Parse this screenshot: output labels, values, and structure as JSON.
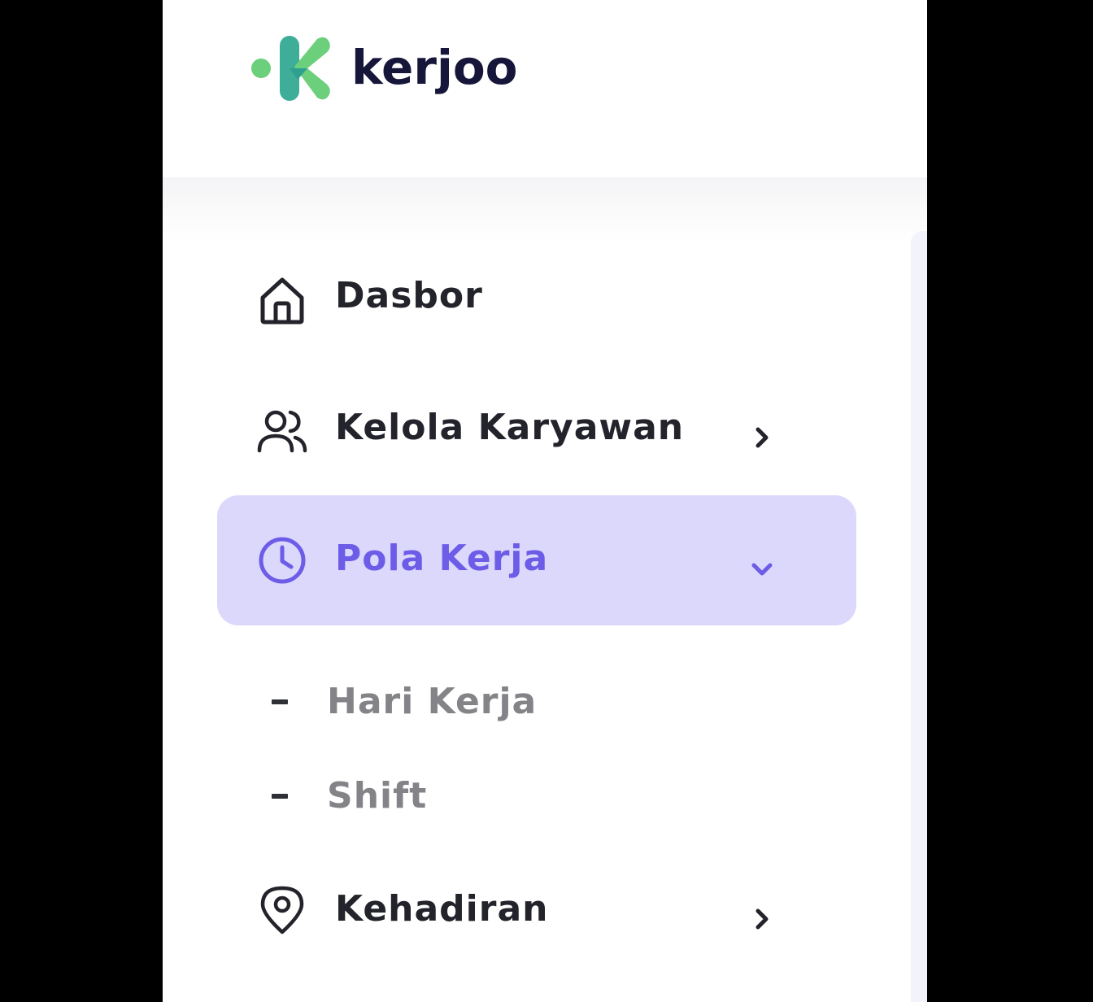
{
  "brand": {
    "name": "kerjoo",
    "logo_colors": [
      "#6ccf7b",
      "#3fae99",
      "#2ea08f"
    ],
    "text_color": "#16163a"
  },
  "sidebar": {
    "active_bg": "#dcd8fc",
    "active_color": "#6c5ce7",
    "items": [
      {
        "label": "Dasbor",
        "icon": "home-icon",
        "has_chevron": false
      },
      {
        "label": "Kelola Karyawan",
        "icon": "users-icon",
        "has_chevron": true,
        "chevron": "chevron-right-icon"
      },
      {
        "label": "Pola Kerja",
        "icon": "clock-icon",
        "active": true,
        "expanded": true,
        "chevron": "chevron-down-icon",
        "children": [
          {
            "label": "Hari Kerja"
          },
          {
            "label": "Shift"
          }
        ]
      },
      {
        "label": "Kehadiran",
        "icon": "map-pin-icon",
        "has_chevron": true,
        "chevron": "chevron-right-icon"
      }
    ]
  }
}
